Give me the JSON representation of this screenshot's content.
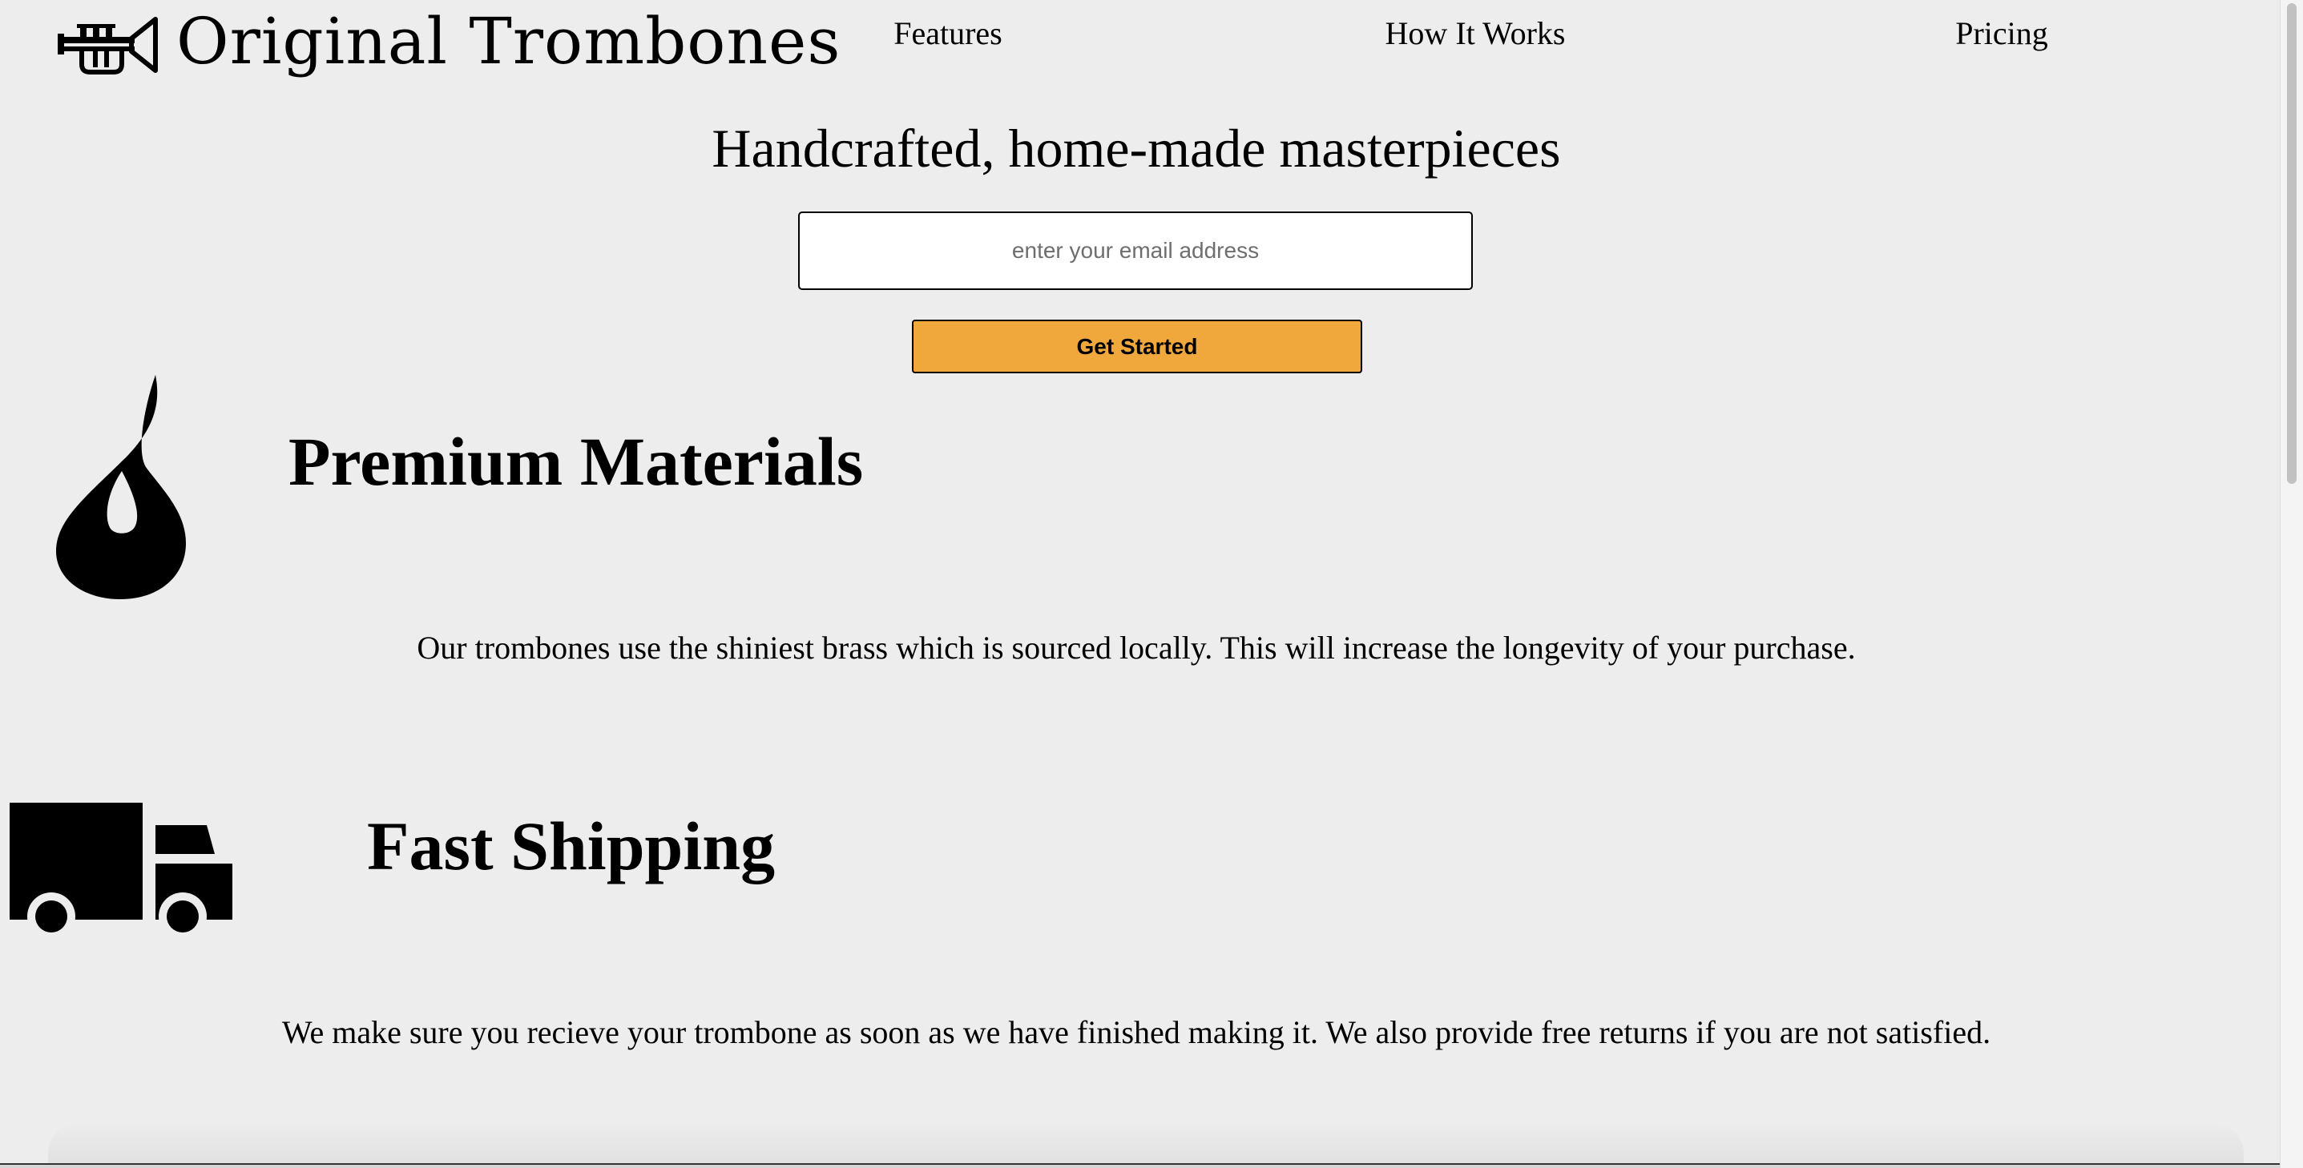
{
  "header": {
    "brand": "Original Trombones",
    "logo_icon": "trumpet-icon",
    "nav": [
      {
        "label": "Features"
      },
      {
        "label": "How It Works"
      },
      {
        "label": "Pricing"
      }
    ]
  },
  "hero": {
    "headline": "Handcrafted, home-made masterpieces",
    "email_value": "",
    "email_placeholder": "enter your email address",
    "cta_label": "Get Started",
    "cta_color": "#f0a83c"
  },
  "features": [
    {
      "icon": "fire-icon",
      "title": "Premium Materials",
      "text": "Our trombones use the shiniest brass which is sourced locally. This will increase the longevity of your purchase."
    },
    {
      "icon": "truck-icon",
      "title": "Fast Shipping",
      "text": "We make sure you recieve your trombone as soon as we have finished making it. We also provide free returns if you are not satisfied."
    }
  ],
  "colors": {
    "background": "#ededed",
    "text": "#000000",
    "accent": "#f0a83c"
  }
}
